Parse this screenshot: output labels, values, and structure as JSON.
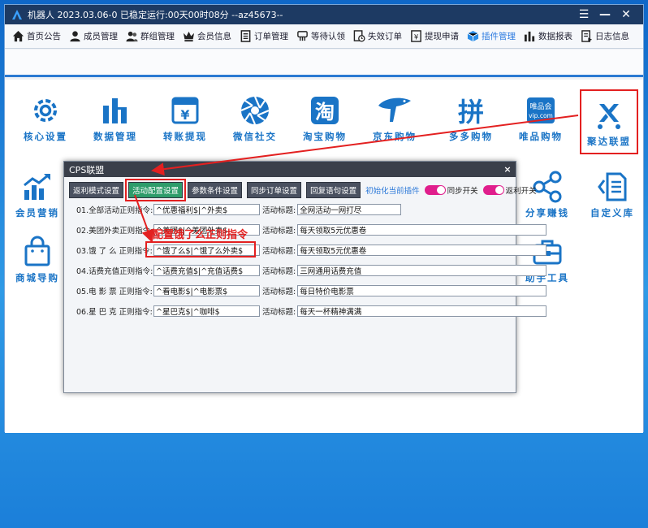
{
  "window": {
    "title": "机器人  2023.03.06-0 已稳定运行:00天00时08分  --az45673--",
    "controls": [
      "☰",
      "—",
      "✕"
    ]
  },
  "toolbar": [
    {
      "label": "首页公告",
      "icon": "home-icon"
    },
    {
      "label": "成员管理",
      "icon": "user-icon"
    },
    {
      "label": "群组管理",
      "icon": "users-icon"
    },
    {
      "label": "会员信息",
      "icon": "crown-icon"
    },
    {
      "label": "订单管理",
      "icon": "list-icon"
    },
    {
      "label": "等待认领",
      "icon": "hand-icon"
    },
    {
      "label": "失效订单",
      "icon": "clock-doc-icon"
    },
    {
      "label": "提现申请",
      "icon": "money-doc-icon"
    },
    {
      "label": "插件管理",
      "icon": "cube-icon",
      "active": true
    },
    {
      "label": "数据报表",
      "icon": "bar-chart-icon"
    },
    {
      "label": "日志信息",
      "icon": "log-icon"
    }
  ],
  "modules": {
    "core": "核心设置",
    "data": "数据管理",
    "withdraw": "转账提现",
    "wechat": "微信社交",
    "taobao": "淘宝购物",
    "jd": "京东购物",
    "pdd": "多多购物",
    "vip": "唯品购物",
    "juda": "聚达联盟",
    "member": "会员营销",
    "share": "分享赚钱",
    "custom": "自定义库",
    "mall": "商城导购",
    "helper": "助手工具"
  },
  "icon_text": {
    "taobao": "淘",
    "pdd": "拼",
    "vip_top": "唯品会",
    "vip_bottom": "vip.com",
    "money": "¥"
  },
  "dialog": {
    "title": "CPS联盟",
    "close": "×",
    "tabs": [
      "返利模式设置",
      "活动配置设置",
      "参数条件设置",
      "同步订单设置",
      "回复语句设置"
    ],
    "selected_tab": 1,
    "note": "初始化当前插件",
    "toggle_sync": "同步开关",
    "toggle_rebate": "返利开关",
    "title_label": "活动标题:",
    "rules": [
      {
        "label": "01.全部活动正则指令:",
        "cmd": "^优惠福利$|^外卖$",
        "title": "全网活动一网打尽"
      },
      {
        "label": "02.美团外卖正则指令:",
        "cmd": "^美团$|^美团外卖$",
        "title": "每天领取5元优惠卷"
      },
      {
        "label": "03.饿 了 么 正则指令:",
        "cmd": "^饿了么$|^饿了么外卖$",
        "title": "每天领取5元优惠卷"
      },
      {
        "label": "04.话费充值正则指令:",
        "cmd": "^话费充值$|^充值话费$",
        "title": "三网通用话费充值"
      },
      {
        "label": "05.电 影 票 正则指令:",
        "cmd": "^看电影$|^电影票$",
        "title": "每日特价电影票"
      },
      {
        "label": "06.星 巴 克 正则指令:",
        "cmd": "^星巴克$|^咖啡$",
        "title": "每天一杯精神满满"
      }
    ]
  },
  "callout": "配置饿了么正则指令",
  "colors": {
    "accent": "#2b7ad2",
    "highlight": "#e32020",
    "toggle": "#e01e8c",
    "tab_selected": "#2e9c6a"
  }
}
